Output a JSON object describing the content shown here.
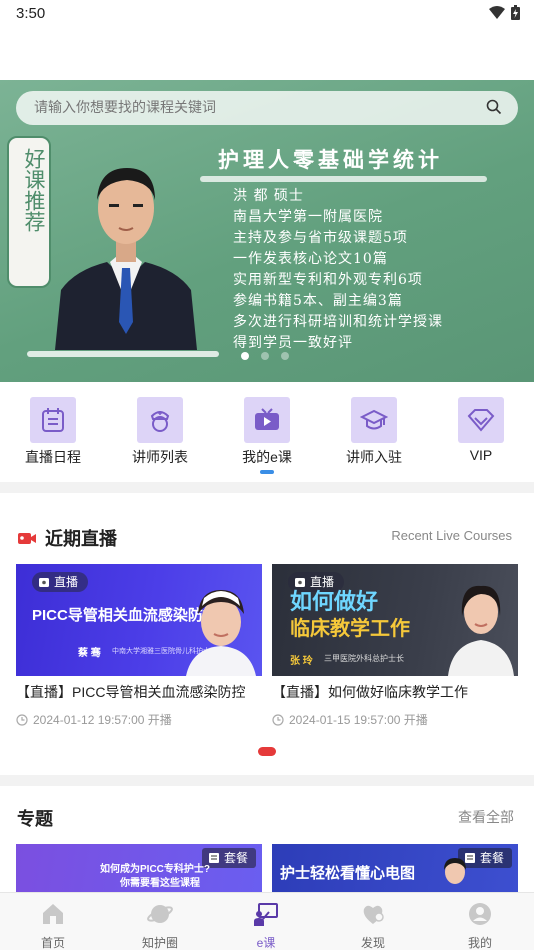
{
  "status_bar": {
    "time": "3:50"
  },
  "search": {
    "placeholder": "请输入你想要找的课程关键词"
  },
  "banner": {
    "tag": "好课推荐",
    "title": "护理人零基础学统计",
    "lines": [
      "洪 都  硕士",
      "南昌大学第一附属医院",
      "主持及参与省市级课题5项",
      "一作发表核心论文10篇",
      "实用新型专利和外观专利6项",
      "参编书籍5本、副主编3篇",
      "多次进行科研培训和统计学授课",
      "得到学员一致好评"
    ]
  },
  "quick_nav": [
    {
      "label": "直播日程",
      "icon": "calendar-icon"
    },
    {
      "label": "讲师列表",
      "icon": "nurse-icon"
    },
    {
      "label": "我的e课",
      "icon": "video-play-icon"
    },
    {
      "label": "讲师入驻",
      "icon": "graduation-cap-icon"
    },
    {
      "label": "VIP",
      "icon": "diamond-icon"
    }
  ],
  "live": {
    "title": "近期直播",
    "subtitle": "Recent Live Courses",
    "badge": "直播",
    "courses": [
      {
        "thumb_title": "PICC导管相关血流感染防控",
        "thumb_name": "蔡 骞",
        "thumb_role": "中南大学湘雅三医院骨儿科护士长",
        "title": "【直播】PICC导管相关血流感染防控",
        "time": "2024-01-12 19:57:00 开播"
      },
      {
        "thumb_title_line1": "如何做好",
        "thumb_title_line2": "临床教学工作",
        "thumb_name": "张 玲",
        "thumb_role": "三甲医院外科总护士长",
        "title": "【直播】如何做好临床教学工作",
        "time": "2024-01-15 19:57:00 开播"
      }
    ]
  },
  "topics": {
    "title": "专题",
    "view_all": "查看全部",
    "badge": "套餐",
    "cards": [
      {
        "line1": "如何成为PICC专科护士?",
        "line2": "你需要看这些课程"
      },
      {
        "line1": "护士轻松看懂心电图"
      }
    ]
  },
  "tabs": [
    {
      "label": "首页",
      "icon": "home-icon"
    },
    {
      "label": "知护圈",
      "icon": "planet-icon"
    },
    {
      "label": "e课",
      "icon": "classroom-icon",
      "active": true
    },
    {
      "label": "发现",
      "icon": "discover-icon"
    },
    {
      "label": "我的",
      "icon": "profile-icon"
    }
  ],
  "colors": {
    "accent": "#7a5cc8",
    "live_red": "#e53a3a",
    "banner_green": "#6ea888"
  }
}
